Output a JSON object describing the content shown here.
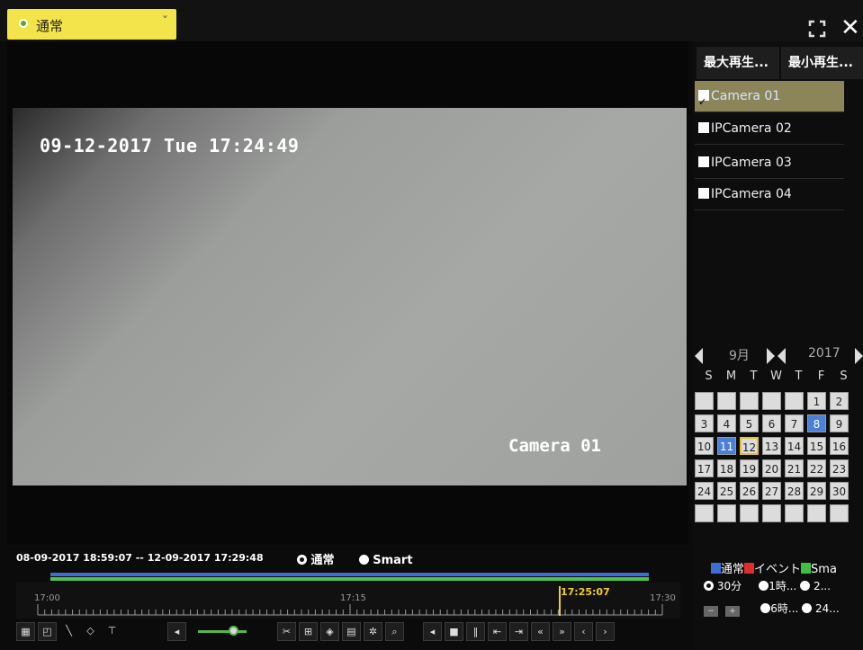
{
  "header": {
    "mode_label": "通常",
    "close_label": "✕"
  },
  "video": {
    "osd_datetime": "09-12-2017 Tue 17:24:49",
    "osd_camera": "Camera 01"
  },
  "playback_buttons": {
    "max": "最大再生...",
    "min": "最小再生..."
  },
  "cameras": [
    {
      "label": "Camera 01",
      "checked": true
    },
    {
      "label": "IPCamera 02",
      "checked": false
    },
    {
      "label": "IPCamera 03",
      "checked": false
    },
    {
      "label": "IPCamera 04",
      "checked": false
    }
  ],
  "calendar": {
    "month": "9月",
    "year": "2017",
    "weekdays": [
      "S",
      "M",
      "T",
      "W",
      "T",
      "F",
      "S"
    ],
    "weeks": [
      [
        "",
        "",
        "",
        "",
        "",
        "1",
        "2"
      ],
      [
        "3",
        "4",
        "5",
        "6",
        "7",
        "8",
        "9"
      ],
      [
        "10",
        "11",
        "12",
        "13",
        "14",
        "15",
        "16"
      ],
      [
        "17",
        "18",
        "19",
        "20",
        "21",
        "22",
        "23"
      ],
      [
        "24",
        "25",
        "26",
        "27",
        "28",
        "29",
        "30"
      ],
      [
        "",
        "",
        "",
        "",
        "",
        "",
        ""
      ]
    ],
    "recorded_days": [
      "8",
      "11"
    ],
    "selected_day": "12"
  },
  "legend": {
    "normal": "通常",
    "event": "イベント",
    "smart": "Sma",
    "colors": {
      "normal": "#3d6ed2",
      "event": "#e02c2c",
      "smart": "#40c040"
    }
  },
  "zoom": {
    "opt_30m": "30分",
    "opt_1h": "1時...",
    "opt_2h": "2...",
    "opt_6h": "6時...",
    "opt_24h": "24..."
  },
  "timeline": {
    "range": "08-09-2017 18:59:07 -- 12-09-2017 17:29:48",
    "type_normal": "通常",
    "type_smart": "Smart",
    "tick_start": "17:00",
    "tick_mid": "17:15",
    "tick_end": "17:30",
    "cursor_time": "17:25:07"
  },
  "icons": {
    "toolbar_left": [
      "grid-icon",
      "crop-icon",
      "line-icon",
      "diamond-icon",
      "filter-icon"
    ],
    "toolbar_right": [
      "cut-icon",
      "tag-add-icon",
      "tag-icon",
      "files-icon",
      "settings-icon",
      "search-icon",
      "reverse-play-icon",
      "stop-icon",
      "pause-icon",
      "step-back-icon",
      "step-forward-icon",
      "rewind-icon",
      "fast-forward-icon",
      "prev-icon",
      "next-icon"
    ]
  }
}
